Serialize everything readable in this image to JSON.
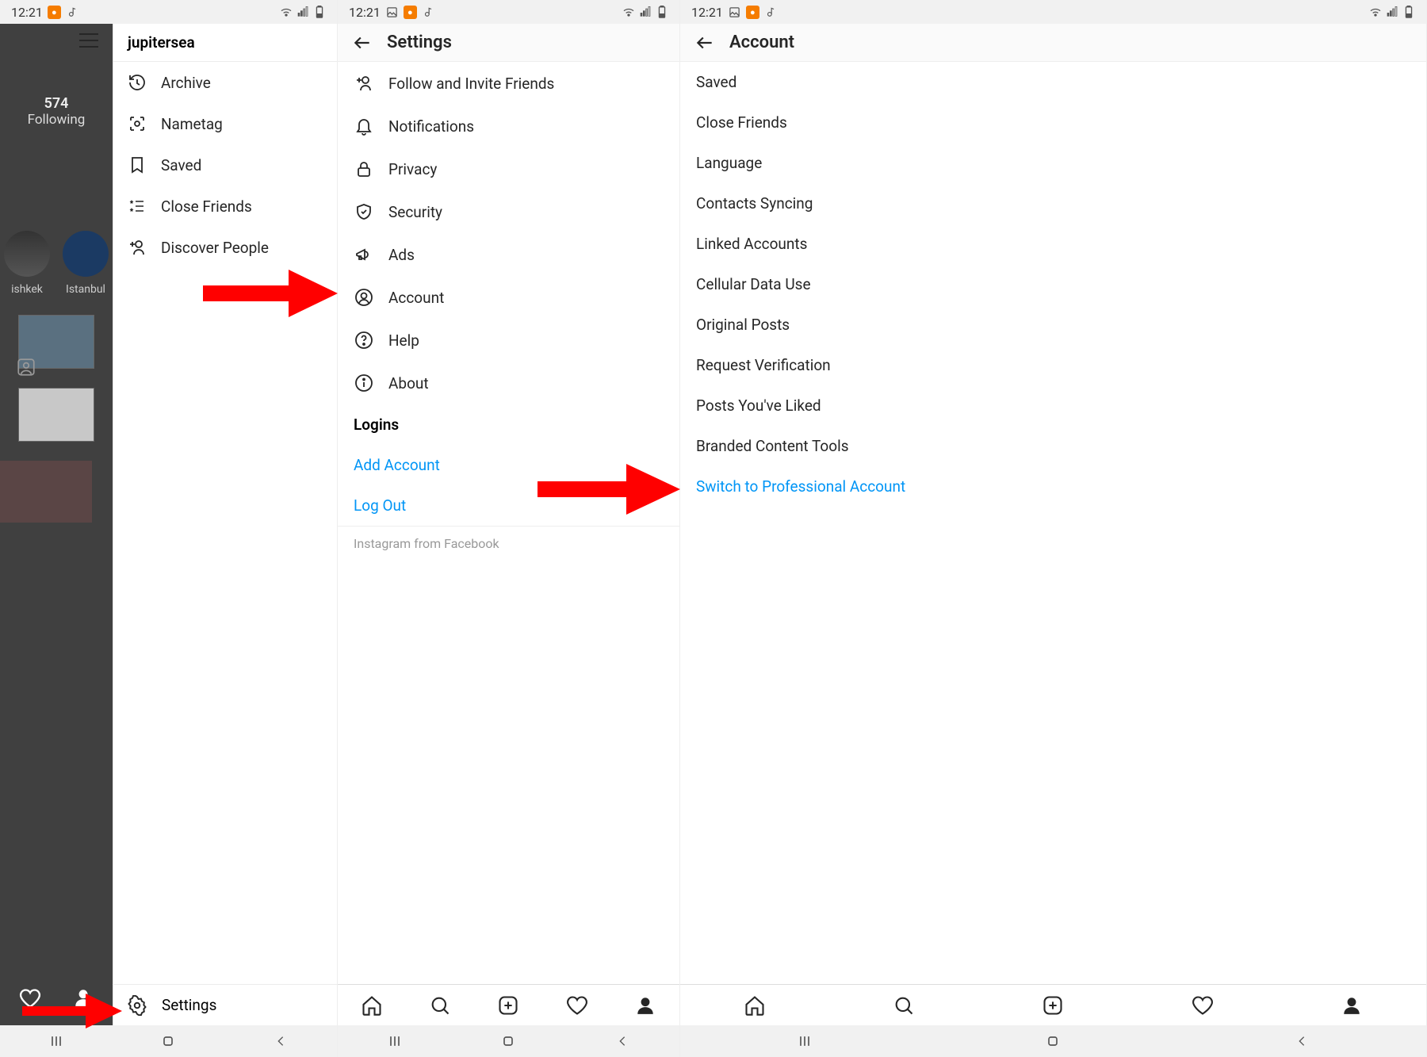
{
  "status_time": "12:21",
  "panel1": {
    "hamburger": "menu",
    "username": "jupitersea",
    "following_count": "574",
    "following_label": "Following",
    "stories": [
      {
        "label": "ishkek"
      },
      {
        "label": "Istanbul"
      }
    ],
    "drawer_items": [
      {
        "icon": "history",
        "label": "Archive"
      },
      {
        "icon": "nametag",
        "label": "Nametag"
      },
      {
        "icon": "bookmark",
        "label": "Saved"
      },
      {
        "icon": "list",
        "label": "Close Friends"
      },
      {
        "icon": "adduser",
        "label": "Discover People"
      }
    ],
    "settings_label": "Settings"
  },
  "panel2": {
    "title": "Settings",
    "items": [
      {
        "icon": "adduser",
        "label": "Follow and Invite Friends"
      },
      {
        "icon": "bell",
        "label": "Notifications"
      },
      {
        "icon": "lock",
        "label": "Privacy"
      },
      {
        "icon": "shield",
        "label": "Security"
      },
      {
        "icon": "megaphone",
        "label": "Ads"
      },
      {
        "icon": "user",
        "label": "Account"
      },
      {
        "icon": "help",
        "label": "Help"
      },
      {
        "icon": "info",
        "label": "About"
      }
    ],
    "section_logins": "Logins",
    "add_account": "Add Account",
    "log_out": "Log Out",
    "footer": "Instagram from Facebook"
  },
  "panel3": {
    "title": "Account",
    "items": [
      "Saved",
      "Close Friends",
      "Language",
      "Contacts Syncing",
      "Linked Accounts",
      "Cellular Data Use",
      "Original Posts",
      "Request Verification",
      "Posts You've Liked",
      "Branded Content Tools"
    ],
    "switch_label": "Switch to Professional Account"
  }
}
